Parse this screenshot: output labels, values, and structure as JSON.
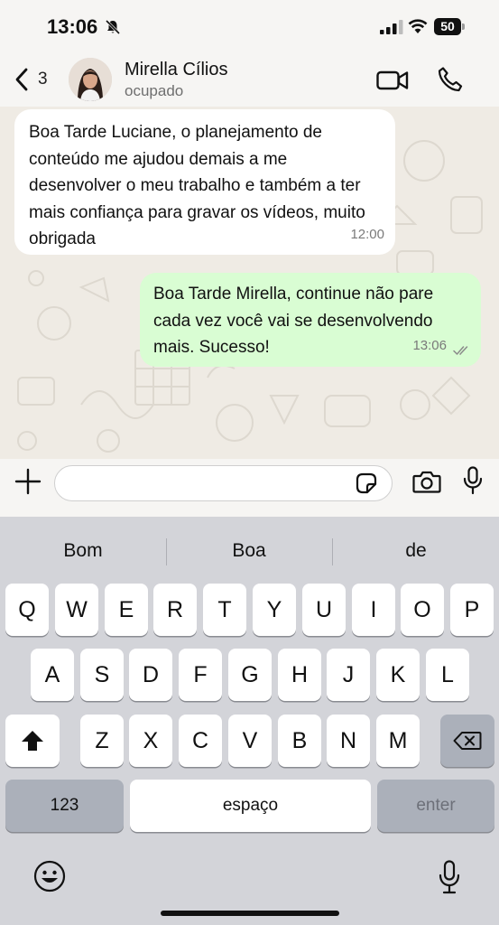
{
  "status_bar": {
    "time": "13:06",
    "battery": "50",
    "icons": [
      "bell-slash-icon",
      "signal-icon",
      "wifi-icon",
      "battery-icon"
    ]
  },
  "header": {
    "back_count": "3",
    "contact_name": "Mirella Cílios",
    "contact_status": "ocupado",
    "icons": [
      "chevron-left-icon",
      "video-camera-icon",
      "phone-icon"
    ]
  },
  "messages": [
    {
      "direction": "incoming",
      "text": "Boa Tarde Luciane, o planejamento de conteúdo me ajudou demais a me desenvolver o meu trabalho e também a ter mais confiança para gravar os vídeos, muito obrigada",
      "time": "12:00"
    },
    {
      "direction": "outgoing",
      "text": "Boa Tarde Mirella, continue não pare cada vez você vai se desenvolvendo mais. Sucesso!",
      "time": "13:06",
      "status": "read"
    }
  ],
  "compose": {
    "placeholder": "",
    "icons": [
      "plus-icon",
      "sticker-icon",
      "camera-icon",
      "microphone-icon"
    ]
  },
  "keyboard": {
    "suggestions": [
      "Bom",
      "Boa",
      "de"
    ],
    "row1": [
      "Q",
      "W",
      "E",
      "R",
      "T",
      "Y",
      "U",
      "I",
      "O",
      "P"
    ],
    "row2": [
      "A",
      "S",
      "D",
      "F",
      "G",
      "H",
      "J",
      "K",
      "L"
    ],
    "row3": [
      "Z",
      "X",
      "C",
      "V",
      "B",
      "N",
      "M"
    ],
    "numbers_key": "123",
    "space_key": "espaço",
    "enter_key": "enter",
    "icons": [
      "shift-icon",
      "backspace-icon",
      "emoji-icon",
      "dictation-mic-icon"
    ]
  },
  "colors": {
    "incoming_bubble": "#ffffff",
    "outgoing_bubble": "#d9fdd3",
    "chat_wallpaper": "#efebe4",
    "read_ticks": "#8a8a8a"
  }
}
